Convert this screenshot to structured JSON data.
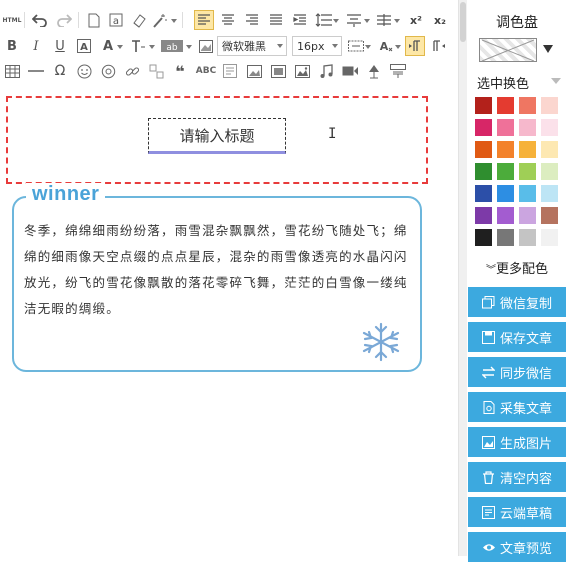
{
  "toolbar": {
    "html_label": "HTML",
    "bold": "B",
    "italic": "I",
    "underline": "U",
    "fontcolor": "A",
    "font_family": "微软雅黑",
    "font_size": "16px",
    "superscript": "x²",
    "subscript": "x₂",
    "row3_abc": "ABC",
    "row3_quote": "❝"
  },
  "title": {
    "placeholder": "请输入标题"
  },
  "card": {
    "label": "winner",
    "text": "冬季，绵绵细雨纷纷落，雨雪混杂飘飘然，雪花纷飞随处飞；绵绵的细雨像天空点缀的点点星辰，混杂的雨雪像透亮的水晶闪闪放光，纷飞的雪花像飘散的落花零碎飞舞，茫茫的白雪像一缕纯洁无暇的绸缎。"
  },
  "sidebar": {
    "palette_title": "调色盘",
    "selected_label": "选中换色",
    "more_colors": "更多配色",
    "swatches": [
      [
        "#b3211b",
        "#e43b30",
        "#ef7662",
        "#fbd6cf"
      ],
      [
        "#d72667",
        "#ef7199",
        "#f6b8cc",
        "#fbe1ea"
      ],
      [
        "#e05a14",
        "#f3822b",
        "#f6b23a",
        "#fde8b2"
      ],
      [
        "#2f8e2f",
        "#4cac3b",
        "#9fcf56",
        "#dcedc0"
      ],
      [
        "#2c4fa8",
        "#2d8ee3",
        "#59bde9",
        "#bde5f5"
      ],
      [
        "#7d3aa8",
        "#a35cd0",
        "#cba5e0",
        "#b5735f"
      ],
      [
        "#1f1f1f",
        "#777777",
        "#c4c4c4",
        "#f1f1f1"
      ]
    ],
    "buttons": [
      {
        "label": "微信复制",
        "icon": "copy-icon"
      },
      {
        "label": "保存文章",
        "icon": "save-icon"
      },
      {
        "label": "同步微信",
        "icon": "sync-icon"
      },
      {
        "label": "采集文章",
        "icon": "collect-icon"
      },
      {
        "label": "生成图片",
        "icon": "image-icon"
      },
      {
        "label": "清空内容",
        "icon": "trash-icon"
      },
      {
        "label": "云端草稿",
        "icon": "cloud-draft-icon"
      },
      {
        "label": "文章预览",
        "icon": "eye-icon"
      }
    ]
  },
  "colors": {
    "accent": "#3ca9df",
    "title_border": "#e83b3b",
    "card_border": "#6cb6dc",
    "card_label": "#4aa3d8"
  }
}
